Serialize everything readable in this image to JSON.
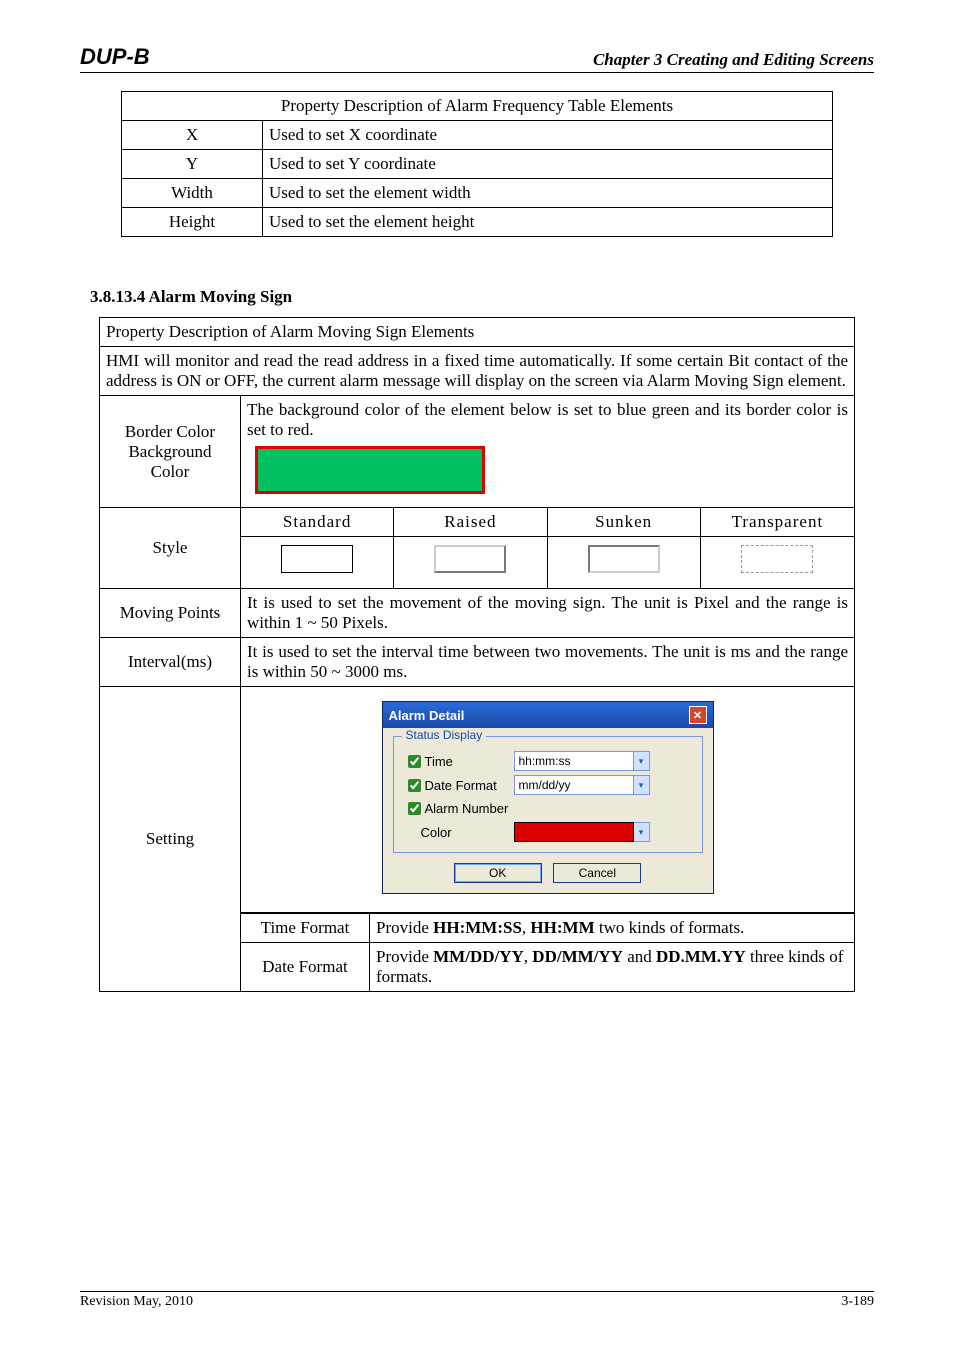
{
  "header": {
    "logo": "DUP-B",
    "chapter": "Chapter 3 Creating and Editing Screens"
  },
  "table1": {
    "title": "Property Description of Alarm Frequency Table Elements",
    "rows": [
      {
        "k": "X",
        "v": "Used to set X coordinate"
      },
      {
        "k": "Y",
        "v": "Used to set Y coordinate"
      },
      {
        "k": "Width",
        "v": "Used to set the element width"
      },
      {
        "k": "Height",
        "v": "Used to set the element height"
      }
    ]
  },
  "section_heading": "3.8.13.4 Alarm Moving Sign",
  "table2": {
    "title": "Property Description of Alarm Moving Sign Elements",
    "intro": "HMI will monitor and read the read address in a fixed time automatically. If some certain Bit contact of the address is ON or OFF, the current alarm message will display on the screen via Alarm Moving Sign element.",
    "border_color_row": {
      "labels": [
        "Border Color",
        "Background",
        "Color"
      ],
      "desc": "The background color of the element below is set to blue green and its border color is set to red."
    },
    "style_row": {
      "label": "Style",
      "headers": [
        "Standard",
        "Raised",
        "Sunken",
        "Transparent"
      ]
    },
    "moving_points": {
      "label": "Moving Points",
      "desc": "It is used to set the movement of the moving sign. The unit is Pixel and the range is within 1 ~ 50 Pixels."
    },
    "interval": {
      "label": "Interval(ms)",
      "desc": "It is used to set the interval time between two movements. The unit is ms and the range is within 50 ~ 3000 ms."
    },
    "setting": {
      "label": "Setting",
      "dialog": {
        "title": "Alarm Detail",
        "group": "Status Display",
        "time_label": "Time",
        "time_value": "hh:mm:ss",
        "date_label": "Date Format",
        "date_value": "mm/dd/yy",
        "alarm_label": "Alarm Number",
        "color_label": "Color",
        "ok": "OK",
        "cancel": "Cancel"
      },
      "time_format": {
        "label": "Time Format",
        "desc_pre": "Provide ",
        "b1": "HH:MM:SS",
        "mid1": ", ",
        "b2": "HH:MM",
        "desc_post": " two kinds of formats."
      },
      "date_format": {
        "label": "Date Format",
        "desc_pre": "Provide ",
        "b1": "MM/DD/YY",
        "mid1": ", ",
        "b2": "DD/MM/YY",
        "mid2": " and ",
        "b3": "DD.MM.YY",
        "desc_post": " three kinds of formats."
      }
    }
  },
  "footer": {
    "revision": "Revision May, 2010",
    "page": "3-189"
  }
}
